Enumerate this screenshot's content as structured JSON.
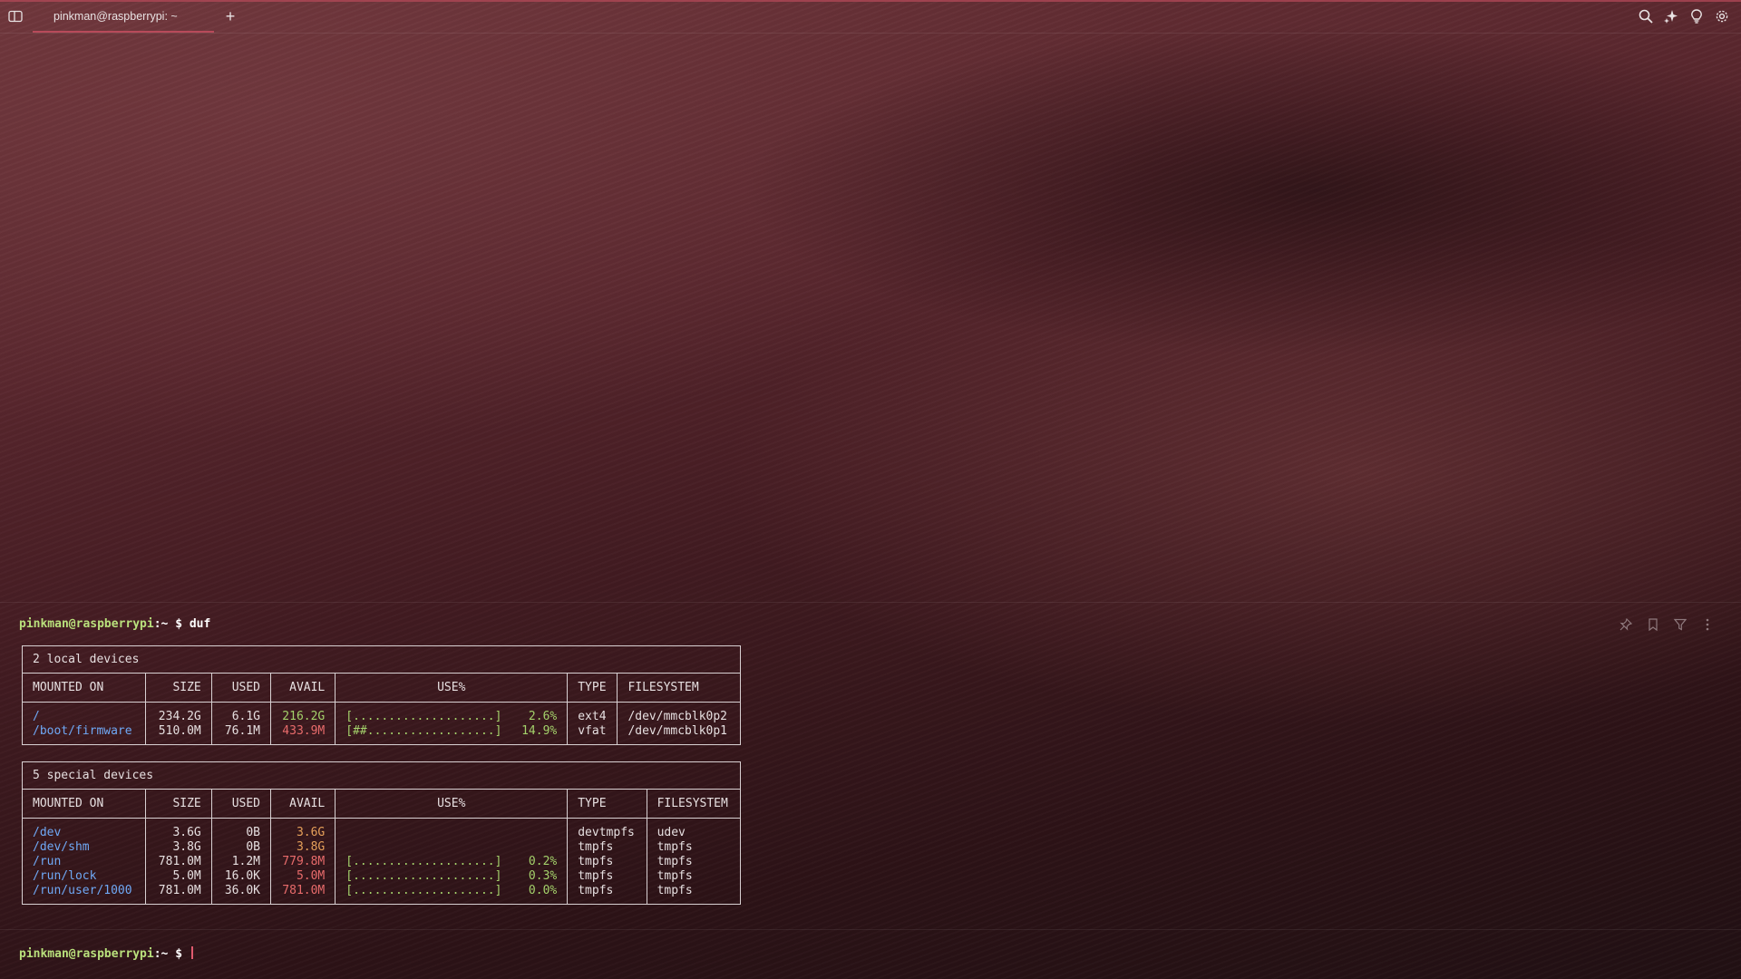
{
  "tab": {
    "title": "pinkman@raspberrypi: ~"
  },
  "prompt": {
    "user_host": "pinkman@raspberrypi",
    "sep": ":",
    "path": "~",
    "symbol": "$"
  },
  "command": "duf",
  "local": {
    "title": "2 local devices",
    "headers": [
      "MOUNTED ON",
      "SIZE",
      "USED",
      "AVAIL",
      "USE%",
      "TYPE",
      "FILESYSTEM"
    ],
    "rows": [
      {
        "mount": "/",
        "size": "234.2G",
        "used": "6.1G",
        "avail": "216.2G",
        "bar": "[....................]",
        "pct": "2.6%",
        "type": "ext4",
        "fs": "/dev/mmcblk0p2"
      },
      {
        "mount": "/boot/firmware",
        "size": "510.0M",
        "used": "76.1M",
        "avail": "433.9M",
        "bar": "[##..................]",
        "pct": "14.9%",
        "type": "vfat",
        "fs": "/dev/mmcblk0p1"
      }
    ]
  },
  "special": {
    "title": "5 special devices",
    "headers": [
      "MOUNTED ON",
      "SIZE",
      "USED",
      "AVAIL",
      "USE%",
      "TYPE",
      "FILESYSTEM"
    ],
    "rows": [
      {
        "mount": "/dev",
        "size": "3.6G",
        "used": "0B",
        "avail": "3.6G",
        "bar": "",
        "pct": "",
        "type": "devtmpfs",
        "fs": "udev"
      },
      {
        "mount": "/dev/shm",
        "size": "3.8G",
        "used": "0B",
        "avail": "3.8G",
        "bar": "",
        "pct": "",
        "type": "tmpfs",
        "fs": "tmpfs"
      },
      {
        "mount": "/run",
        "size": "781.0M",
        "used": "1.2M",
        "avail": "779.8M",
        "bar": "[....................]",
        "pct": "0.2%",
        "type": "tmpfs",
        "fs": "tmpfs"
      },
      {
        "mount": "/run/lock",
        "size": "5.0M",
        "used": "16.0K",
        "avail": "5.0M",
        "bar": "[....................]",
        "pct": "0.3%",
        "type": "tmpfs",
        "fs": "tmpfs"
      },
      {
        "mount": "/run/user/1000",
        "size": "781.0M",
        "used": "36.0K",
        "avail": "781.0M",
        "bar": "[....................]",
        "pct": "0.0%",
        "type": "tmpfs",
        "fs": "tmpfs"
      }
    ]
  },
  "colors": {
    "accent": "#b84a5a",
    "prompt_user": "#b9e07c",
    "mount": "#6fa8f5",
    "avail_ok": "#a4d26b",
    "avail_warn": "#e6a05a",
    "avail_low": "#e86b6b"
  },
  "icons": [
    "sidebar-icon",
    "add-tab-icon",
    "search-icon",
    "ai-sparkle-icon",
    "bulb-icon",
    "settings-icon",
    "pin-icon",
    "bookmark-icon",
    "filter-icon",
    "more-icon"
  ]
}
